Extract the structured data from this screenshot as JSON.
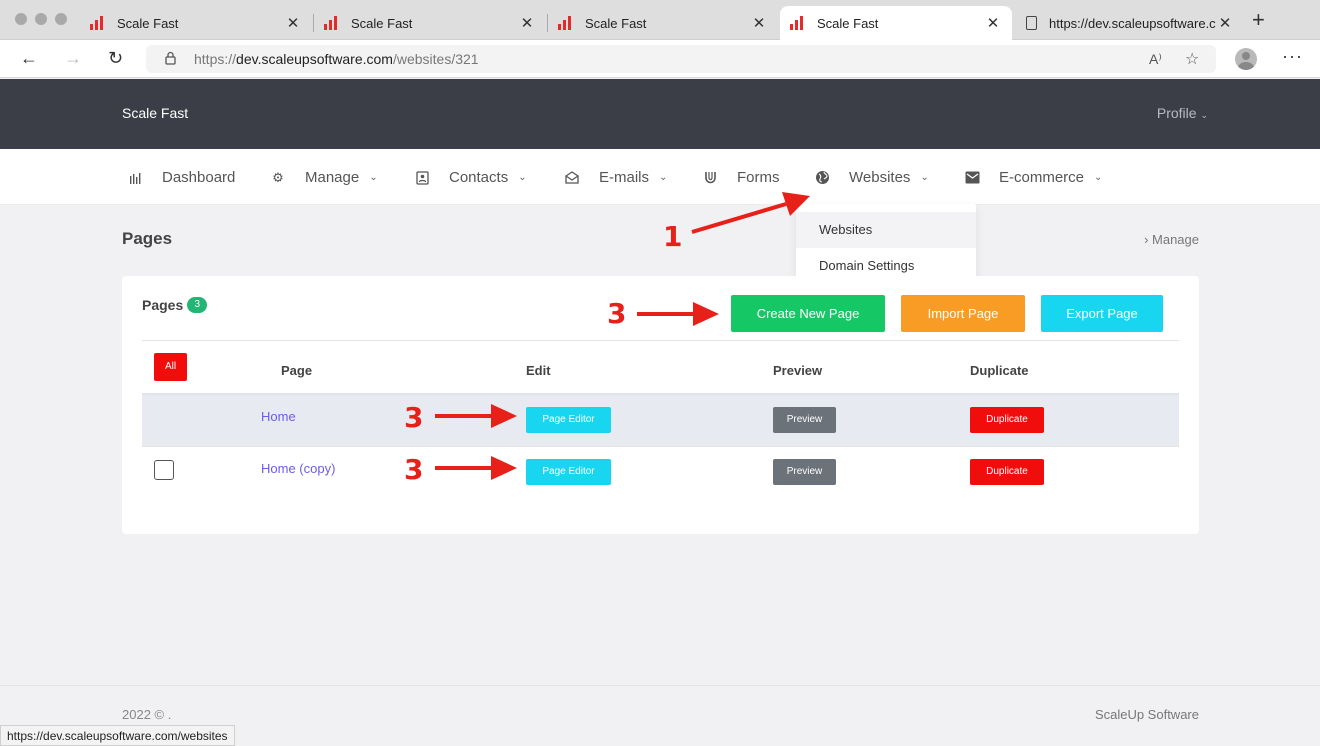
{
  "browser": {
    "tabs": [
      {
        "title": "Scale Fast",
        "close": "✕"
      },
      {
        "title": "Scale Fast",
        "close": "✕"
      },
      {
        "title": "Scale Fast",
        "close": "✕"
      },
      {
        "title": "Scale Fast",
        "close": "✕",
        "active": true
      },
      {
        "title": "https://dev.scaleupsoftware.c",
        "close": "✕"
      }
    ],
    "new_tab": "+",
    "url_prefix": "https://",
    "url_domain": "dev.scaleupsoftware.com",
    "url_path": "/websites/321",
    "back": "←",
    "forward": "→",
    "reload": "↻",
    "read_aloud": "A⁾",
    "favorites": "☆",
    "menu": "···",
    "status_url": "https://dev.scaleupsoftware.com/websites"
  },
  "header": {
    "brand": "Scale Fast",
    "profile": "Profile"
  },
  "nav": {
    "items": [
      {
        "label": "Dashboard",
        "icon": "bar-chart-icon"
      },
      {
        "label": "Manage",
        "icon": "gear-icon",
        "dropdown": true
      },
      {
        "label": "Contacts",
        "icon": "contact-card-icon",
        "dropdown": true
      },
      {
        "label": "E-mails",
        "icon": "envelope-open-icon",
        "dropdown": true
      },
      {
        "label": "Forms",
        "icon": "magnet-icon"
      },
      {
        "label": "Websites",
        "icon": "globe-icon",
        "dropdown": true
      },
      {
        "label": "E-commerce",
        "icon": "envelope-icon",
        "dropdown": true
      }
    ],
    "chevron": "⌄",
    "websites_menu": [
      "Websites",
      "Domain Settings"
    ]
  },
  "page": {
    "title": "Pages",
    "breadcrumb": "›  Manage"
  },
  "card": {
    "title": "Pages",
    "count": "3",
    "buttons": {
      "create": "Create New Page",
      "import": "Import Page",
      "export": "Export Page"
    },
    "columns": {
      "all": "All",
      "page": "Page",
      "edit": "Edit",
      "preview": "Preview",
      "duplicate": "Duplicate"
    },
    "rows": [
      {
        "name": "Home",
        "edit": "Page Editor",
        "preview": "Preview",
        "duplicate": "Duplicate"
      },
      {
        "name": "Home (copy)",
        "edit": "Page Editor",
        "preview": "Preview",
        "duplicate": "Duplicate"
      }
    ]
  },
  "annotations": {
    "step1": "1",
    "step3a": "3",
    "step3b": "3",
    "step3c": "3"
  },
  "footer": {
    "left": "2022 © .",
    "right": "ScaleUp Software"
  },
  "colors": {
    "header_bg": "#3b3e47",
    "green": "#16c765",
    "orange": "#f89c25",
    "cyan": "#18d6ef",
    "red": "#f20d0d",
    "gray": "#6c727a",
    "link": "#6c5ce7",
    "annotation": "#e8201a"
  }
}
